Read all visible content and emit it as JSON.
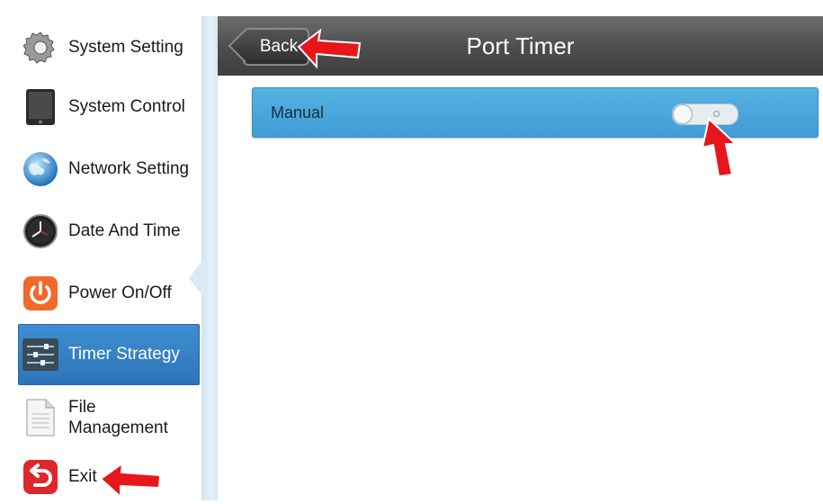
{
  "sidebar": {
    "items": [
      {
        "label": "System Setting",
        "icon": "gear-icon"
      },
      {
        "label": "System Control",
        "icon": "tablet-icon"
      },
      {
        "label": "Network Setting",
        "icon": "globe-icon"
      },
      {
        "label": "Date And Time",
        "icon": "clock-icon"
      },
      {
        "label": "Power On/Off",
        "icon": "power-icon"
      },
      {
        "label": "Timer Strategy",
        "icon": "sliders-icon",
        "active": true
      },
      {
        "label": "File Management",
        "icon": "file-icon"
      },
      {
        "label": "Exit",
        "icon": "exit-icon"
      }
    ]
  },
  "header": {
    "back_label": "Back",
    "title": "Port Timer"
  },
  "settings": {
    "manual_label": "Manual",
    "manual_enabled": false
  },
  "colors": {
    "accent": "#3f9ed6",
    "active_item": "#2c74b8",
    "header": "#4c4c4c",
    "annotation_arrow": "#e8161a"
  }
}
